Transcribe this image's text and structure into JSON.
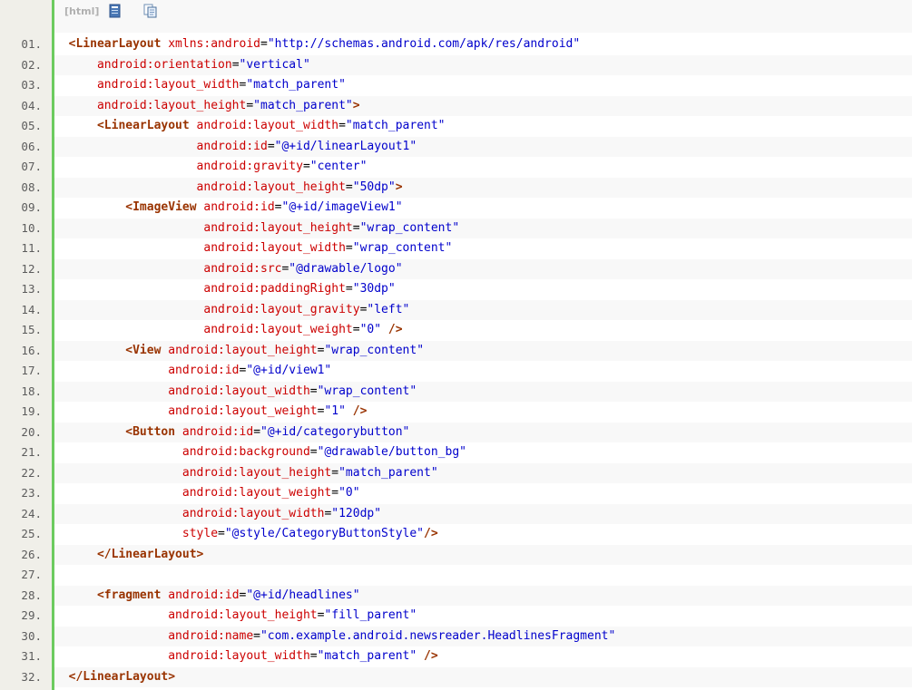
{
  "toolbar": {
    "label": "[html]",
    "icons": [
      "view-source-icon",
      "copy-icon"
    ]
  },
  "lines": [
    {
      "num": "01.",
      "indent": "",
      "tokens": [
        {
          "t": "tag",
          "v": "<LinearLayout"
        },
        {
          "t": "pun",
          "v": " "
        },
        {
          "t": "attr",
          "v": "xmlns:android"
        },
        {
          "t": "pun",
          "v": "="
        },
        {
          "t": "val",
          "v": "\"http://schemas.android.com/apk/res/android\""
        }
      ]
    },
    {
      "num": "02.",
      "indent": "    ",
      "tokens": [
        {
          "t": "attr",
          "v": "android:orientation"
        },
        {
          "t": "pun",
          "v": "="
        },
        {
          "t": "val",
          "v": "\"vertical\""
        }
      ]
    },
    {
      "num": "03.",
      "indent": "    ",
      "tokens": [
        {
          "t": "attr",
          "v": "android:layout_width"
        },
        {
          "t": "pun",
          "v": "="
        },
        {
          "t": "val",
          "v": "\"match_parent\""
        }
      ]
    },
    {
      "num": "04.",
      "indent": "    ",
      "tokens": [
        {
          "t": "attr",
          "v": "android:layout_height"
        },
        {
          "t": "pun",
          "v": "="
        },
        {
          "t": "val",
          "v": "\"match_parent\""
        },
        {
          "t": "tag",
          "v": ">"
        }
      ]
    },
    {
      "num": "05.",
      "indent": "    ",
      "tokens": [
        {
          "t": "tag",
          "v": "<LinearLayout"
        },
        {
          "t": "pun",
          "v": " "
        },
        {
          "t": "attr",
          "v": "android:layout_width"
        },
        {
          "t": "pun",
          "v": "="
        },
        {
          "t": "val",
          "v": "\"match_parent\""
        }
      ]
    },
    {
      "num": "06.",
      "indent": "                  ",
      "tokens": [
        {
          "t": "attr",
          "v": "android:id"
        },
        {
          "t": "pun",
          "v": "="
        },
        {
          "t": "val",
          "v": "\"@+id/linearLayout1\""
        }
      ]
    },
    {
      "num": "07.",
      "indent": "                  ",
      "tokens": [
        {
          "t": "attr",
          "v": "android:gravity"
        },
        {
          "t": "pun",
          "v": "="
        },
        {
          "t": "val",
          "v": "\"center\""
        }
      ]
    },
    {
      "num": "08.",
      "indent": "                  ",
      "tokens": [
        {
          "t": "attr",
          "v": "android:layout_height"
        },
        {
          "t": "pun",
          "v": "="
        },
        {
          "t": "val",
          "v": "\"50dp\""
        },
        {
          "t": "tag",
          "v": ">"
        }
      ]
    },
    {
      "num": "09.",
      "indent": "        ",
      "tokens": [
        {
          "t": "tag",
          "v": "<ImageView"
        },
        {
          "t": "pun",
          "v": " "
        },
        {
          "t": "attr",
          "v": "android:id"
        },
        {
          "t": "pun",
          "v": "="
        },
        {
          "t": "val",
          "v": "\"@+id/imageView1\""
        }
      ]
    },
    {
      "num": "10.",
      "indent": "                   ",
      "tokens": [
        {
          "t": "attr",
          "v": "android:layout_height"
        },
        {
          "t": "pun",
          "v": "="
        },
        {
          "t": "val",
          "v": "\"wrap_content\""
        }
      ]
    },
    {
      "num": "11.",
      "indent": "                   ",
      "tokens": [
        {
          "t": "attr",
          "v": "android:layout_width"
        },
        {
          "t": "pun",
          "v": "="
        },
        {
          "t": "val",
          "v": "\"wrap_content\""
        }
      ]
    },
    {
      "num": "12.",
      "indent": "                   ",
      "tokens": [
        {
          "t": "attr",
          "v": "android:src"
        },
        {
          "t": "pun",
          "v": "="
        },
        {
          "t": "val",
          "v": "\"@drawable/logo\""
        }
      ]
    },
    {
      "num": "13.",
      "indent": "                   ",
      "tokens": [
        {
          "t": "attr",
          "v": "android:paddingRight"
        },
        {
          "t": "pun",
          "v": "="
        },
        {
          "t": "val",
          "v": "\"30dp\""
        }
      ]
    },
    {
      "num": "14.",
      "indent": "                   ",
      "tokens": [
        {
          "t": "attr",
          "v": "android:layout_gravity"
        },
        {
          "t": "pun",
          "v": "="
        },
        {
          "t": "val",
          "v": "\"left\""
        }
      ]
    },
    {
      "num": "15.",
      "indent": "                   ",
      "tokens": [
        {
          "t": "attr",
          "v": "android:layout_weight"
        },
        {
          "t": "pun",
          "v": "="
        },
        {
          "t": "val",
          "v": "\"0\""
        },
        {
          "t": "pun",
          "v": " "
        },
        {
          "t": "tag",
          "v": "/>"
        }
      ]
    },
    {
      "num": "16.",
      "indent": "        ",
      "tokens": [
        {
          "t": "tag",
          "v": "<View"
        },
        {
          "t": "pun",
          "v": " "
        },
        {
          "t": "attr",
          "v": "android:layout_height"
        },
        {
          "t": "pun",
          "v": "="
        },
        {
          "t": "val",
          "v": "\"wrap_content\""
        }
      ]
    },
    {
      "num": "17.",
      "indent": "              ",
      "tokens": [
        {
          "t": "attr",
          "v": "android:id"
        },
        {
          "t": "pun",
          "v": "="
        },
        {
          "t": "val",
          "v": "\"@+id/view1\""
        }
      ]
    },
    {
      "num": "18.",
      "indent": "              ",
      "tokens": [
        {
          "t": "attr",
          "v": "android:layout_width"
        },
        {
          "t": "pun",
          "v": "="
        },
        {
          "t": "val",
          "v": "\"wrap_content\""
        }
      ]
    },
    {
      "num": "19.",
      "indent": "              ",
      "tokens": [
        {
          "t": "attr",
          "v": "android:layout_weight"
        },
        {
          "t": "pun",
          "v": "="
        },
        {
          "t": "val",
          "v": "\"1\""
        },
        {
          "t": "pun",
          "v": " "
        },
        {
          "t": "tag",
          "v": "/>"
        }
      ]
    },
    {
      "num": "20.",
      "indent": "        ",
      "tokens": [
        {
          "t": "tag",
          "v": "<Button"
        },
        {
          "t": "pun",
          "v": " "
        },
        {
          "t": "attr",
          "v": "android:id"
        },
        {
          "t": "pun",
          "v": "="
        },
        {
          "t": "val",
          "v": "\"@+id/categorybutton\""
        }
      ]
    },
    {
      "num": "21.",
      "indent": "                ",
      "tokens": [
        {
          "t": "attr",
          "v": "android:background"
        },
        {
          "t": "pun",
          "v": "="
        },
        {
          "t": "val",
          "v": "\"@drawable/button_bg\""
        }
      ]
    },
    {
      "num": "22.",
      "indent": "                ",
      "tokens": [
        {
          "t": "attr",
          "v": "android:layout_height"
        },
        {
          "t": "pun",
          "v": "="
        },
        {
          "t": "val",
          "v": "\"match_parent\""
        }
      ]
    },
    {
      "num": "23.",
      "indent": "                ",
      "tokens": [
        {
          "t": "attr",
          "v": "android:layout_weight"
        },
        {
          "t": "pun",
          "v": "="
        },
        {
          "t": "val",
          "v": "\"0\""
        }
      ]
    },
    {
      "num": "24.",
      "indent": "                ",
      "tokens": [
        {
          "t": "attr",
          "v": "android:layout_width"
        },
        {
          "t": "pun",
          "v": "="
        },
        {
          "t": "val",
          "v": "\"120dp\""
        }
      ]
    },
    {
      "num": "25.",
      "indent": "                ",
      "tokens": [
        {
          "t": "attr",
          "v": "style"
        },
        {
          "t": "pun",
          "v": "="
        },
        {
          "t": "val",
          "v": "\"@style/CategoryButtonStyle\""
        },
        {
          "t": "tag",
          "v": "/>"
        }
      ]
    },
    {
      "num": "26.",
      "indent": "    ",
      "tokens": [
        {
          "t": "tag",
          "v": "</LinearLayout>"
        }
      ]
    },
    {
      "num": "27.",
      "indent": "",
      "tokens": []
    },
    {
      "num": "28.",
      "indent": "    ",
      "tokens": [
        {
          "t": "tag",
          "v": "<fragment"
        },
        {
          "t": "pun",
          "v": " "
        },
        {
          "t": "attr",
          "v": "android:id"
        },
        {
          "t": "pun",
          "v": "="
        },
        {
          "t": "val",
          "v": "\"@+id/headlines\""
        }
      ]
    },
    {
      "num": "29.",
      "indent": "              ",
      "tokens": [
        {
          "t": "attr",
          "v": "android:layout_height"
        },
        {
          "t": "pun",
          "v": "="
        },
        {
          "t": "val",
          "v": "\"fill_parent\""
        }
      ]
    },
    {
      "num": "30.",
      "indent": "              ",
      "tokens": [
        {
          "t": "attr",
          "v": "android:name"
        },
        {
          "t": "pun",
          "v": "="
        },
        {
          "t": "val",
          "v": "\"com.example.android.newsreader.HeadlinesFragment\""
        }
      ]
    },
    {
      "num": "31.",
      "indent": "              ",
      "tokens": [
        {
          "t": "attr",
          "v": "android:layout_width"
        },
        {
          "t": "pun",
          "v": "="
        },
        {
          "t": "val",
          "v": "\"match_parent\""
        },
        {
          "t": "pun",
          "v": " "
        },
        {
          "t": "tag",
          "v": "/>"
        }
      ]
    },
    {
      "num": "32.",
      "indent": "",
      "tokens": [
        {
          "t": "tag",
          "v": "</LinearLayout>"
        }
      ]
    }
  ]
}
